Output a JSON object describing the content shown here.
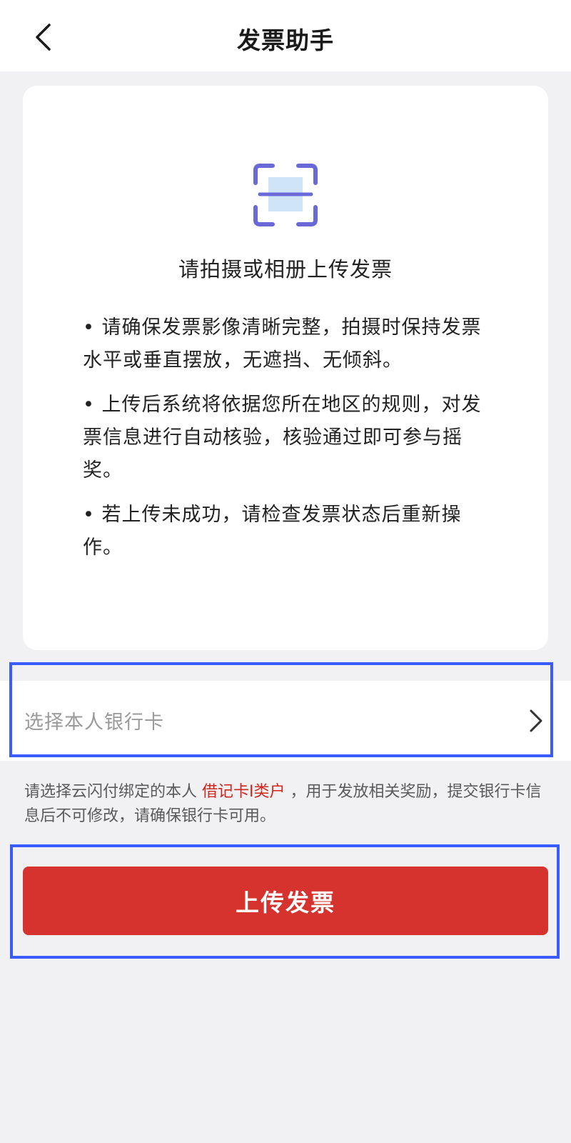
{
  "header": {
    "title": "发票助手",
    "back_icon": "chevron-left-icon"
  },
  "card": {
    "scan_icon": "scan-icon",
    "heading": "请拍摄或相册上传发票",
    "tips": [
      "• 请确保发票影像清晰完整，拍摄时保持发票水平或垂直摆放，无遮挡、无倾斜。",
      "• 上传后系统将依据您所在地区的规则，对发票信息进行自动核验，核验通过即可参与摇奖。",
      "• 若上传未成功，请检查发票状态后重新操作。"
    ]
  },
  "bank_select": {
    "placeholder": "选择本人银行卡",
    "chevron_icon": "chevron-right-icon"
  },
  "note": {
    "before": "请选择云闪付绑定的本人 ",
    "highlight": "借记卡I类户",
    "after": " ，用于发放相关奖励，提交银行卡信息后不可修改，请确保银行卡可用。"
  },
  "upload_button": {
    "label": "上传发票"
  },
  "colors": {
    "accent_red": "#d6322e",
    "highlight_red_text": "#d0251f",
    "annotation_blue": "#3a5cff",
    "scan_icon_purple": "#6b68d8",
    "scan_icon_fill": "#cfe4f7"
  }
}
